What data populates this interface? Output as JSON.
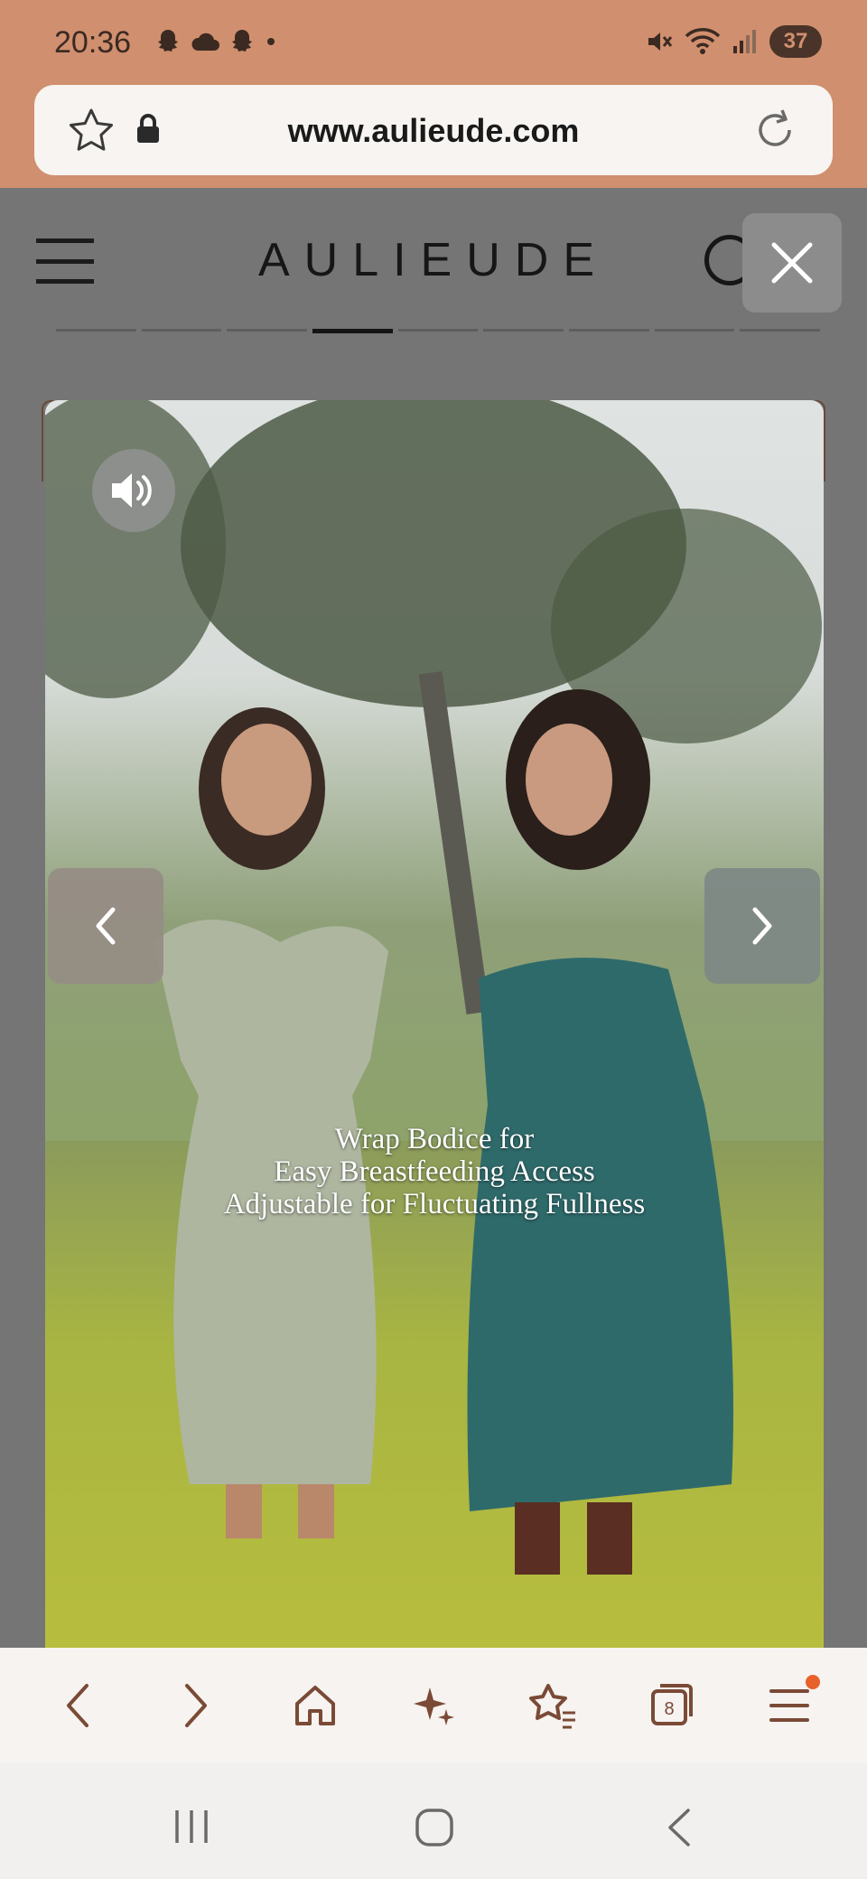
{
  "status_bar": {
    "time": "20:36",
    "battery": "37",
    "left_icons": [
      "snapchat-icon",
      "cloud-icon",
      "snapchat-icon",
      "dot-icon"
    ],
    "right_icons": [
      "mute-icon",
      "wifi-icon",
      "signal-icon",
      "battery-icon"
    ]
  },
  "browser": {
    "url": "www.aulieude.com"
  },
  "site": {
    "logo": "AULIEUDE"
  },
  "video": {
    "caption_lines": [
      "Wrap Bodice for",
      "Easy Breastfeeding Access",
      "Adjustable for Fluctuating Fullness"
    ]
  },
  "toolbar": {
    "tabs_count": "8",
    "items": [
      "back-icon",
      "forward-icon",
      "home-icon",
      "sparkle-icon",
      "bookmarks-icon",
      "tabs-icon",
      "menu-icon"
    ]
  },
  "colors": {
    "status_bar": "#d08f6e",
    "overlay": "#757575",
    "toolbar_icons": "#7a4a36",
    "menu_badge": "#e8612a"
  }
}
